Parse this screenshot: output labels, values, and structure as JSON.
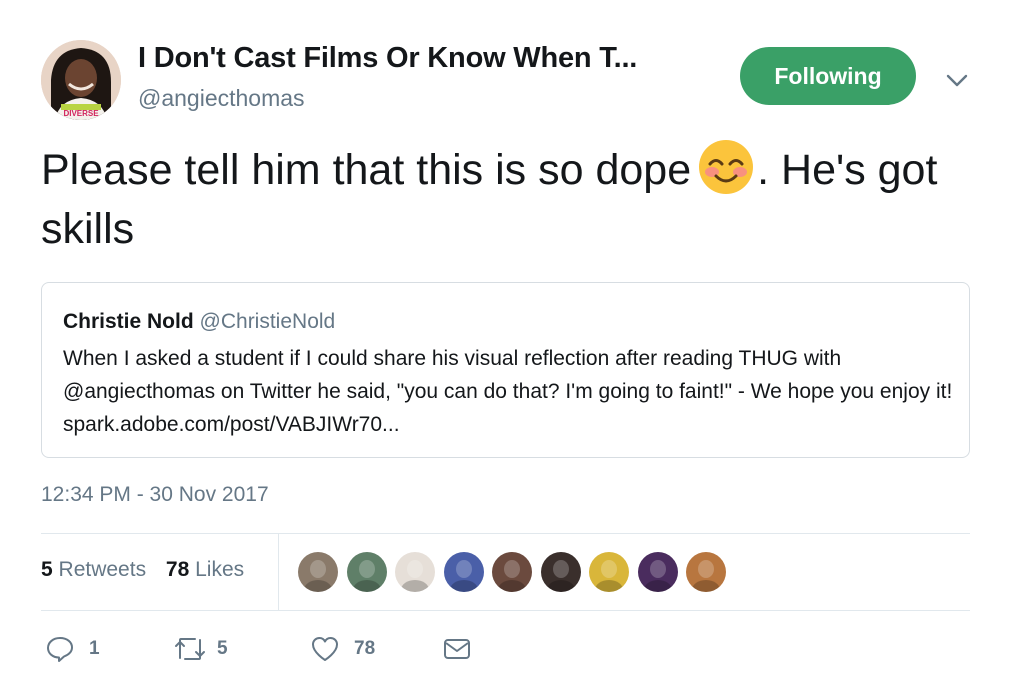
{
  "author": {
    "display_name": "I Don't Cast Films Or Know When T...",
    "handle": "@angiecthomas",
    "avatar_text": "DIVERSE"
  },
  "follow_button": {
    "label": "Following",
    "color": "#3aa067"
  },
  "tweet": {
    "text_before_emoji": "Please tell him that this is so dope",
    "emoji": "smiling-face-with-smiling-eyes",
    "text_after_emoji": ". He's got skills"
  },
  "quoted_tweet": {
    "name": "Christie Nold",
    "handle": "@ChristieNold",
    "text": "When I asked a student if I could share his visual reflection after reading THUG with @angiecthomas on Twitter he said, \"you can do that? I'm going to faint!\" - We hope you enjoy it! spark.adobe.com/post/VABJIWr70..."
  },
  "timestamp": "12:34 PM - 30 Nov 2017",
  "stats": {
    "retweets_count": "5",
    "retweets_label": "Retweets",
    "likes_count": "78",
    "likes_label": "Likes"
  },
  "likers": [
    {
      "name": "liker-1",
      "color": "#8a7a6a"
    },
    {
      "name": "liker-2",
      "color": "#5f7f68"
    },
    {
      "name": "liker-3",
      "color": "#e6dfd8"
    },
    {
      "name": "liker-4",
      "color": "#4a5fa8"
    },
    {
      "name": "liker-5",
      "color": "#6b4a3e"
    },
    {
      "name": "liker-6",
      "color": "#3a2f2c"
    },
    {
      "name": "liker-7",
      "color": "#d9b63a"
    },
    {
      "name": "liker-8",
      "color": "#4a2c5e"
    },
    {
      "name": "liker-9",
      "color": "#b8763f"
    }
  ],
  "actions": {
    "reply_count": "1",
    "retweet_count": "5",
    "like_count": "78"
  },
  "colors": {
    "text_secondary": "#657786",
    "divider": "#e1e8ed",
    "accent_green": "#3aa067"
  }
}
